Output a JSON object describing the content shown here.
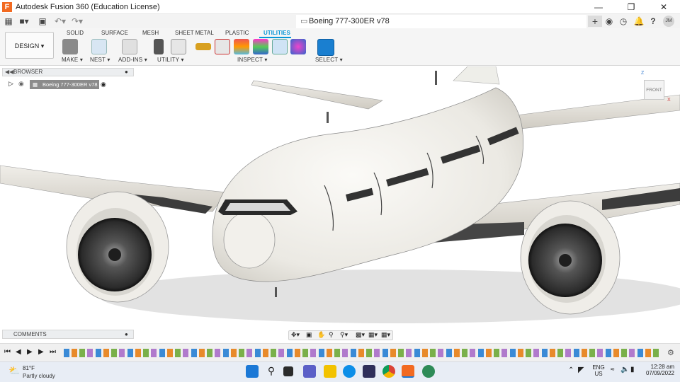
{
  "window": {
    "title": "Autodesk Fusion 360 (Education License)",
    "app_icon": "F"
  },
  "document_tab": {
    "title": "Boeing 777-300ER v78",
    "user_initials": "JM"
  },
  "ribbon": {
    "workspace": "DESIGN",
    "tabs": [
      "SOLID",
      "SURFACE",
      "MESH",
      "SHEET METAL",
      "PLASTIC",
      "UTILITIES"
    ],
    "active_tab": "UTILITIES",
    "groups": [
      "MAKE",
      "NEST",
      "ADD-INS",
      "UTILITY",
      "INSPECT",
      "SELECT"
    ],
    "accent": "#0696d7"
  },
  "browser": {
    "title": "BROWSER",
    "root_component": "Boeing 777-300ER v78"
  },
  "comments": {
    "title": "COMMENTS"
  },
  "viewcube": {
    "face": "FRONT",
    "axis_z": "Z",
    "axis_x": "X"
  },
  "taskbar": {
    "weather_temp": "81°F",
    "weather_desc": "Partly cloudy",
    "lang": "ENG",
    "region": "US",
    "time": "12:28 am",
    "date": "07/09/2022"
  }
}
